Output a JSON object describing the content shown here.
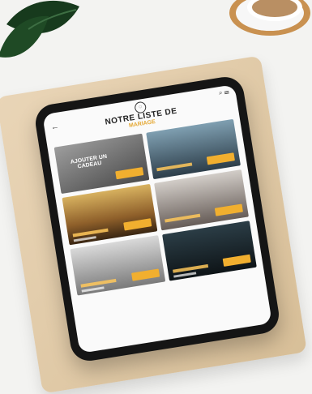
{
  "screen": {
    "title": "NOTRE LISTE DE",
    "subtitle": "MARIAGE"
  },
  "cards": [
    {
      "text": "AJOUTER UN CADEAU",
      "button": ""
    },
    {
      "button": ""
    },
    {
      "button": ""
    },
    {
      "button": ""
    },
    {
      "button": ""
    },
    {
      "button": ""
    }
  ]
}
